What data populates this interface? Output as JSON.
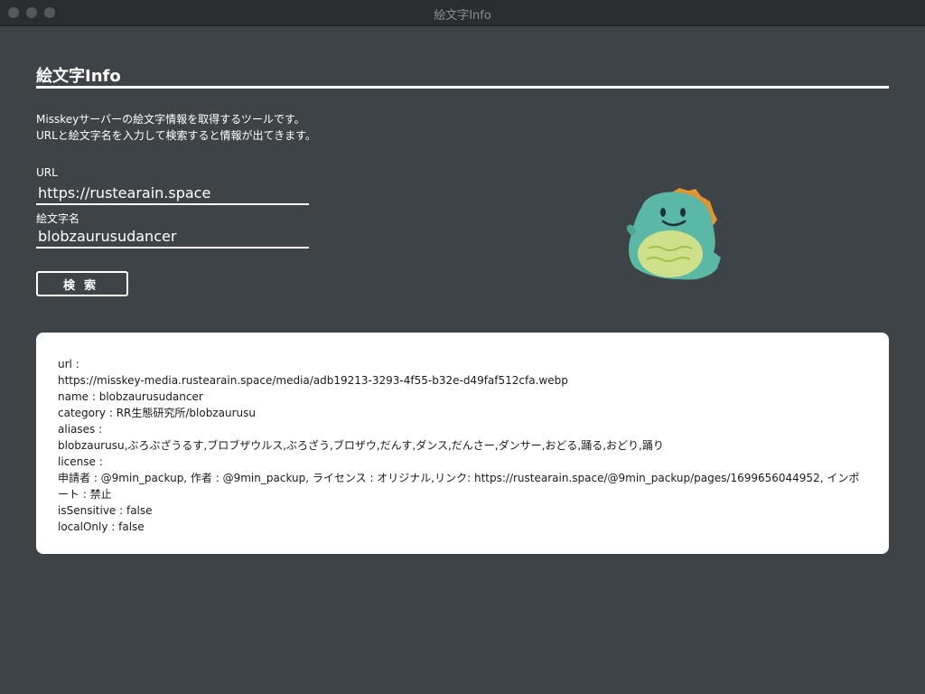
{
  "window": {
    "title": "絵文字Info"
  },
  "page": {
    "title": "絵文字Info",
    "description_line1": "Misskeyサーバーの絵文字情報を取得するツールです。",
    "description_line2": "URLと絵文字名を入力して検索すると情報が出てきます。"
  },
  "form": {
    "url_label": "URL",
    "url_value": "https://rustearain.space",
    "emoji_label": "絵文字名",
    "emoji_value": "blobzaurusudancer",
    "search_label": "検索"
  },
  "emoji_preview": {
    "icon": "blobzaurusu-dancer-icon",
    "body_color": "#5ab8a6",
    "belly_color": "#cfe08a",
    "spike_color": "#e0952f"
  },
  "result": {
    "lines": [
      "url :",
      "https://misskey-media.rustearain.space/media/adb19213-3293-4f55-b32e-d49faf512cfa.webp",
      "name : blobzaurusudancer",
      "category : RR生態研究所/blobzaurusu",
      "aliases :",
      "blobzaurusu,ぶろぶざうるす,ブロブザウルス,ぶろざう,ブロザウ,だんす,ダンス,だんさー,ダンサー,おどる,踊る,おどり,踊り",
      "license :",
      "申請者 : @9min_packup, 作者 : @9min_packup, ライセンス : オリジナル,リンク: https://rustearain.space/@9min_packup/pages/1699656044952, インポート : 禁止",
      "isSensitive : false",
      "localOnly : false"
    ]
  }
}
